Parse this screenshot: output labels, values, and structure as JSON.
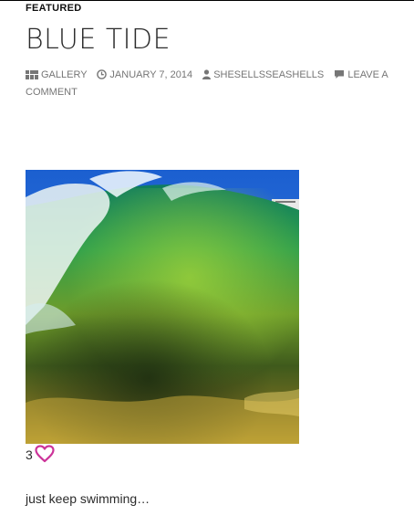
{
  "post": {
    "category": "FEATURED",
    "title": "BLUE TIDE",
    "meta": {
      "format": "GALLERY",
      "date": "JANUARY 7, 2014",
      "author": "SHESELLSSEASHELLS",
      "comment": "LEAVE A COMMENT"
    },
    "image_alt": "Curling green wave",
    "likes": {
      "count": "3"
    },
    "excerpt": "just keep swimming…"
  },
  "icons": {
    "format": "gallery-icon",
    "date": "clock-icon",
    "author": "user-icon",
    "comment": "comment-bubble-icon",
    "like": "heart-icon"
  },
  "colors": {
    "meta_text": "#767676",
    "heart": "#cc3399",
    "water_green": "#3aa54a",
    "sky_blue": "#1f6fd6"
  }
}
